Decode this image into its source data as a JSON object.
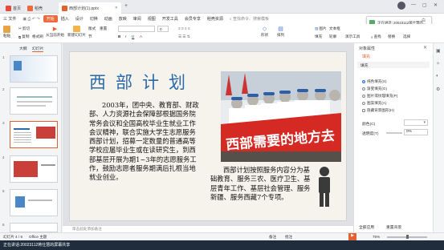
{
  "tabs": [
    {
      "label": "首页",
      "color": "#e24c3b"
    },
    {
      "label": "稻壳",
      "color": "#ec6a3d"
    },
    {
      "label": "西部计划(1).pptx",
      "color": "#e3602f"
    }
  ],
  "window": {
    "time": "48:13"
  },
  "menu": {
    "file": "三 文件",
    "items": [
      "开始",
      "插入",
      "设计",
      "切换",
      "动画",
      "放映",
      "审阅",
      "视图",
      "开发工具",
      "会员专享",
      "稻壳资源"
    ],
    "active_index": 0,
    "search": "查找命令、搜索模板",
    "share": "分享"
  },
  "meeting_popup": {
    "line1": "正在讲话: 20023112蒋仕慧的...",
    "line2": "",
    "label": "白"
  },
  "ribbon": {
    "paste": "粘贴",
    "format_painter": "格式刷",
    "cut": "剪切",
    "copy": "复制",
    "from_current": "从当前开始",
    "new_slide": "新建幻灯片",
    "layout": "版式",
    "section": "节",
    "reset": "重置",
    "font_size": "0",
    "bold": "B",
    "italic": "I",
    "underline": "U",
    "shape": "形状",
    "arrange": "排列",
    "picture": "图片",
    "textbox": "文本框",
    "fill": "填充",
    "outline": "轮廓",
    "find": "查找",
    "select": "选择",
    "replace": "替换",
    "transition": "演示工具"
  },
  "left_pane": {
    "tab_outline": "大纲",
    "tab_slides": "幻灯片",
    "slide_numbers": [
      "1",
      "2",
      "3",
      "4",
      "5",
      "6"
    ],
    "selected": 2
  },
  "slide": {
    "title": "西部计划",
    "para1": "2003年，团中央、教育部、财政部、人力资源社会保障部根据国务院常务会议和全国高校毕业生就业工作会议精神，联合实施大学生志愿服务西部计划，招募一定数量的普通高等学校应届毕业生或在读研究生，到西部基层开展为期1~3年的志愿服务工作，鼓励志愿者服务期满后扎根当地就业创业。",
    "para2": "西部计划按照服务内容分为基础教育、服务三农、医疗卫生、基层青年工作、基层社会管理、服务新疆、服务西藏7个专项。",
    "banner_text": "西部需要的地方去"
  },
  "right_pane": {
    "title": "对象属性",
    "tab_fill": "填充",
    "section": "填充",
    "options": [
      "纯色填充(S)",
      "渐变填充(G)",
      "图片或纹理填充(P)",
      "图案填充(A)",
      "隐藏背景图形(H)"
    ],
    "selected_option": 0,
    "color_label": "颜色(C)",
    "transparency_label": "透明度(T)",
    "transparency_value": "0%",
    "apply_all": "全部应用",
    "reset_bg": "重置背景"
  },
  "notes_placeholder": "单击此处添加备注",
  "status": {
    "slide_info": "幻灯片 4 / 6",
    "theme": "Office 主题",
    "zoom": "75%",
    "notes": "备注",
    "comments": "批注"
  },
  "taskbar": {
    "speaker": "正在讲话:20023112蒋仕慧的屏幕共享"
  },
  "colors": {
    "accent": "#e3602f",
    "title_blue": "#2a6aa8",
    "banner_red": "#d42a23"
  },
  "icons": [
    "paste-icon",
    "cut-icon",
    "copy-icon",
    "play-icon",
    "new-slide-icon",
    "bold-icon",
    "shape-icon",
    "picture-icon",
    "find-icon",
    "person-icon",
    "close-icon",
    "minimize-icon",
    "maximize-icon"
  ]
}
